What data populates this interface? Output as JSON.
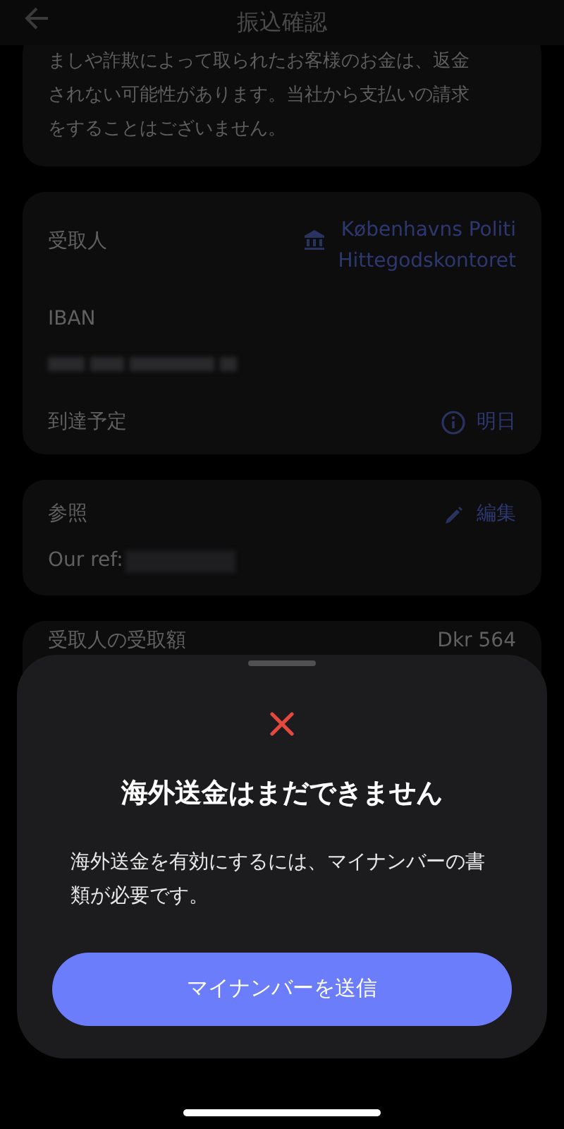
{
  "header": {
    "title": "振込確認"
  },
  "notice": {
    "lines": [
      "ましや詐欺によって取られたお客様のお金は、返金",
      "されない可能性があります。当社から支払いの請求",
      "をすることはございません。"
    ]
  },
  "recipient": {
    "label": "受取人",
    "name_lines": [
      "Københavns Politi",
      "Hittegodskontoret"
    ]
  },
  "iban": {
    "label": "IBAN"
  },
  "arrival": {
    "label": "到達予定",
    "value": "明日"
  },
  "reference": {
    "label": "参照",
    "edit": "編集",
    "value": "Our ref:"
  },
  "received": {
    "label": "受取人の受取額",
    "amount": "Dkr 564"
  },
  "sheet": {
    "title": "海外送金はまだできません",
    "message": "海外送金を有効にするには、マイナンバーの書類が必要です。",
    "button": "マイナンバーを送信"
  }
}
